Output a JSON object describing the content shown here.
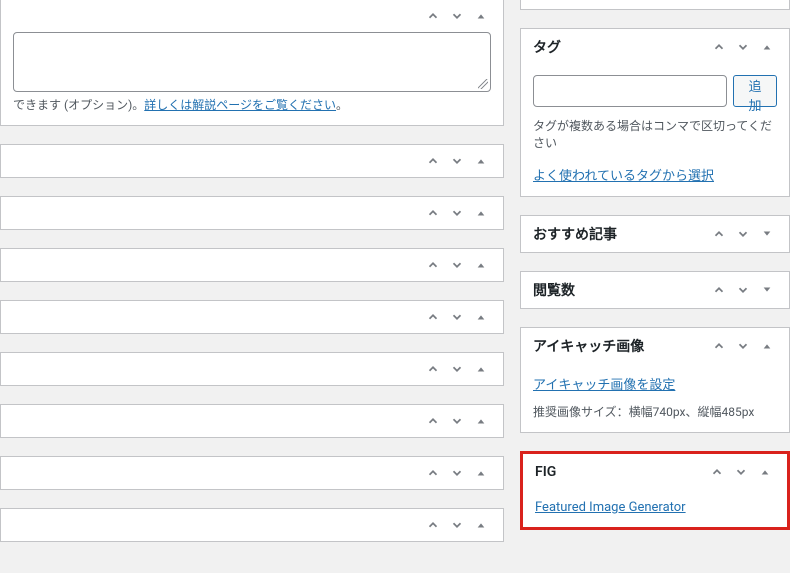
{
  "main": {
    "caption_prefix": "できます (オプション)。",
    "caption_link": "詳しくは解説ページをご覧ください",
    "caption_suffix": "。"
  },
  "side": {
    "tags": {
      "title": "タグ",
      "add_button": "追加",
      "placeholder": "",
      "note": "タグが複数ある場合はコンマで区切ってください",
      "popular_link": "よく使われているタグから選択"
    },
    "recommend": {
      "title": "おすすめ記事"
    },
    "views": {
      "title": "閲覧数"
    },
    "featured": {
      "title": "アイキャッチ画像",
      "set_link": "アイキャッチ画像を設定",
      "rec_size": "推奨画像サイズ：横幅740px、縦幅485px"
    },
    "fig": {
      "title": "FIG",
      "link": "Featured Image Generator"
    }
  }
}
